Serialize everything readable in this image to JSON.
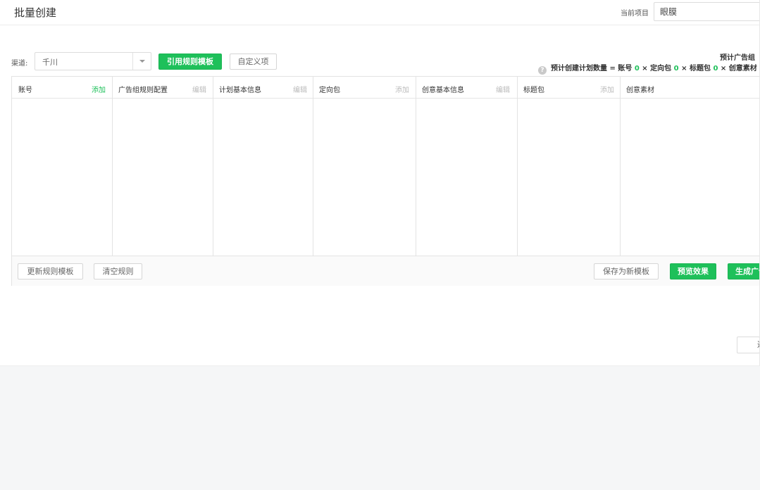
{
  "header": {
    "title": "批量创建",
    "project_label": "当前项目",
    "project_value": "眼膜"
  },
  "toolbar": {
    "channel_label": "渠道:",
    "channel_value": "千川",
    "apply_template": "引用规则模板",
    "custom_item": "自定义项"
  },
  "estimate": {
    "title": "预计广告组",
    "prefix": "预计创建计划数量 = 账号",
    "account_count": "0",
    "targeting_label": "定向包",
    "targeting_count": "0",
    "title_pkg_label": "标题包",
    "title_pkg_count": "0",
    "creative_label": "创意素材",
    "times": "×"
  },
  "table": {
    "columns": [
      {
        "name": "账号",
        "action": "添加",
        "action_style": "green"
      },
      {
        "name": "广告组规则配置",
        "action": "编辑",
        "action_style": "gray"
      },
      {
        "name": "计划基本信息",
        "action": "编辑",
        "action_style": "gray"
      },
      {
        "name": "定向包",
        "action": "添加",
        "action_style": "gray"
      },
      {
        "name": "创意基本信息",
        "action": "编辑",
        "action_style": "gray"
      },
      {
        "name": "标题包",
        "action": "添加",
        "action_style": "gray"
      },
      {
        "name": "创意素材",
        "action": "",
        "action_style": "gray"
      }
    ]
  },
  "footer": {
    "update_template": "更新规则模板",
    "clear_rules": "清空规则",
    "save_new_template": "保存为新模板",
    "preview": "预览效果",
    "generate": "生成广告"
  },
  "bottom": {
    "back": "返回"
  },
  "colors": {
    "accent": "#1ec05a",
    "border": "#e3e3e3",
    "muted": "#bbbbbb"
  },
  "icons": {
    "help": "question-circle-icon",
    "dropdown": "caret-down-icon"
  }
}
